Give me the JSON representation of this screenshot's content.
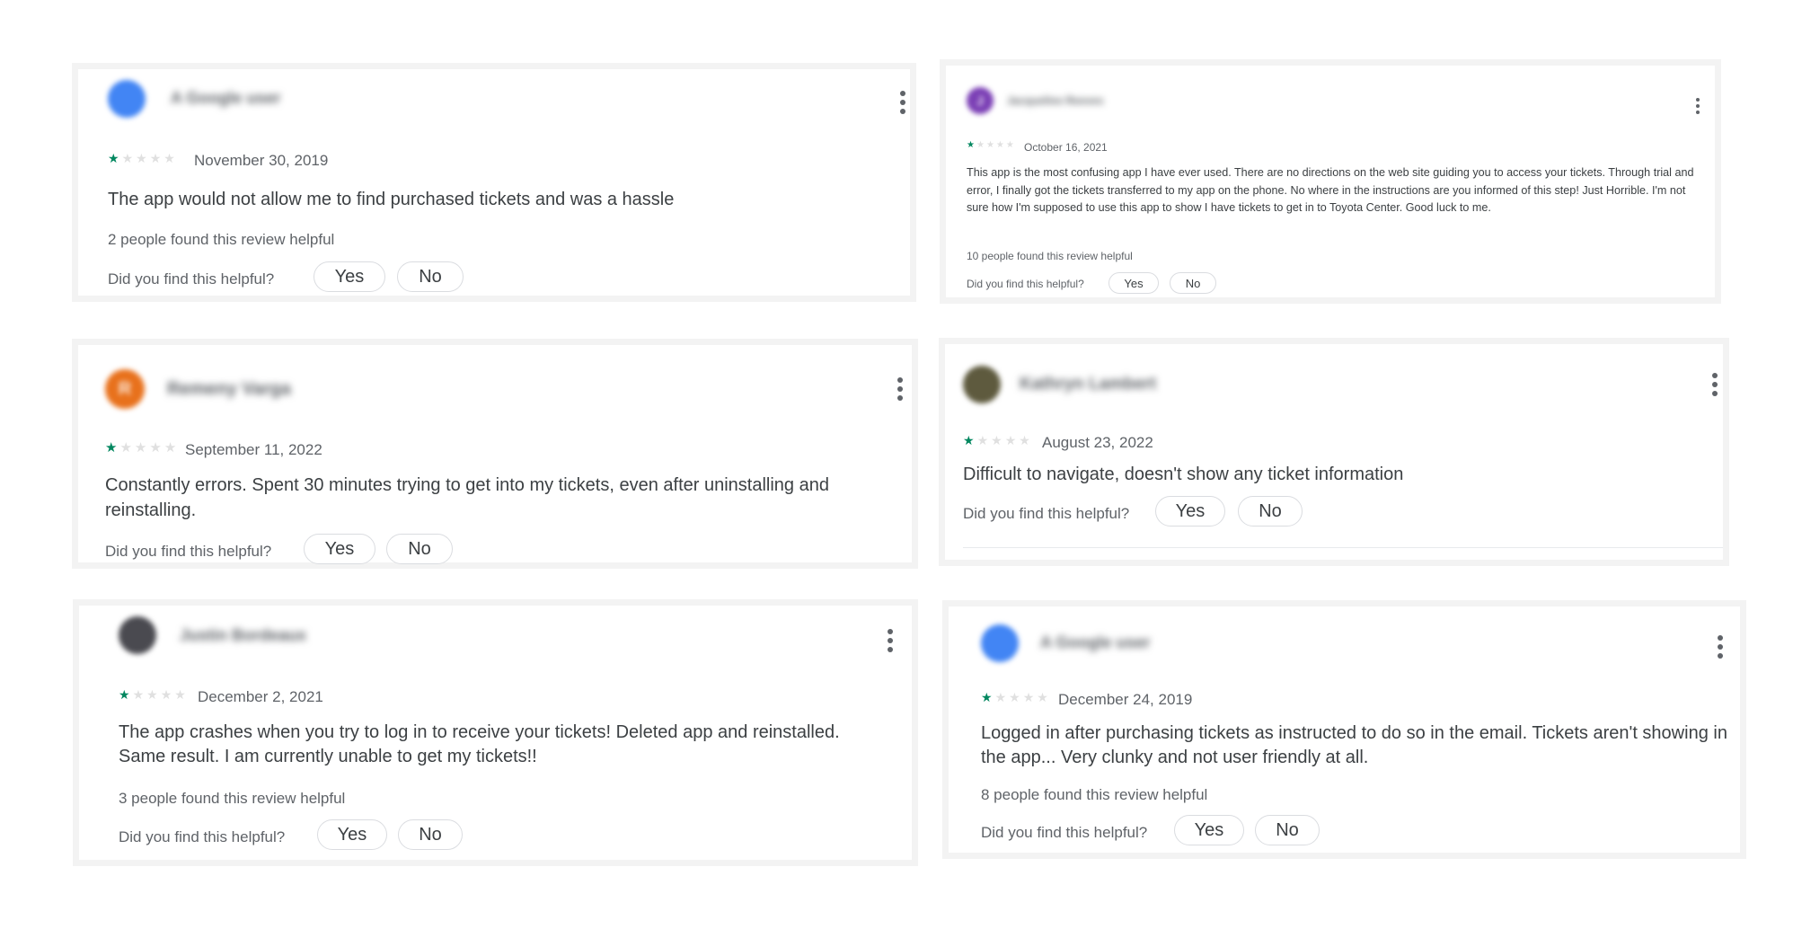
{
  "ui": {
    "question": "Did you find this helpful?",
    "yes_label": "Yes",
    "no_label": "No"
  },
  "colors": {
    "star_on": "#01875f",
    "star_off": "#e0e0e0",
    "text": "#3c4043",
    "muted": "#5f6368"
  },
  "reviews": [
    {
      "user": "A Google user",
      "avatar_letter": "",
      "avatar_color": "#4285f4",
      "rating": 1,
      "date": "November 30, 2019",
      "text": "The app would not allow me to find purchased tickets and was a hassle",
      "helpful_count_text": "2 people found this review helpful"
    },
    {
      "user": "Jacqueline Reeves",
      "avatar_letter": "J",
      "avatar_color": "#7b3fb5",
      "rating": 1,
      "date": "October 16, 2021",
      "text": "This app is the most confusing app I have ever used. There are no directions on the web site guiding you to access your tickets. Through trial and error, I finally got the tickets transferred to my app on the phone. No where in the instructions are you informed of this step! Just Horrible. I'm not sure how I'm supposed to use this app to show I have tickets to get in to Toyota Center. Good luck to me.",
      "helpful_count_text": "10 people found this review helpful"
    },
    {
      "user": "Remeny Varga",
      "avatar_letter": "R",
      "avatar_color": "#e8711c",
      "rating": 1,
      "date": "September 11, 2022",
      "text": "Constantly errors. Spent 30 minutes trying to get into my tickets, even after uninstalling and reinstalling.",
      "helpful_count_text": ""
    },
    {
      "user": "Kathryn Lambert",
      "avatar_letter": "",
      "avatar_color": "#5e5a3e",
      "rating": 1,
      "date": "August 23, 2022",
      "text": "Difficult to navigate, doesn't show any ticket information",
      "helpful_count_text": ""
    },
    {
      "user": "Justin Bordeaux",
      "avatar_letter": "",
      "avatar_color": "#4a4a50",
      "rating": 1,
      "date": "December 2, 2021",
      "text": "The app crashes when you try to log in to receive your tickets! Deleted app and reinstalled. Same result. I am currently unable to get my tickets!!",
      "helpful_count_text": "3 people found this review helpful"
    },
    {
      "user": "A Google user",
      "avatar_letter": "",
      "avatar_color": "#4285f4",
      "rating": 1,
      "date": "December 24, 2019",
      "text": "Logged in after purchasing tickets as instructed to do so in the email. Tickets aren't showing in the app... Very clunky and not user friendly at all.",
      "helpful_count_text": "8 people found this review helpful"
    }
  ]
}
